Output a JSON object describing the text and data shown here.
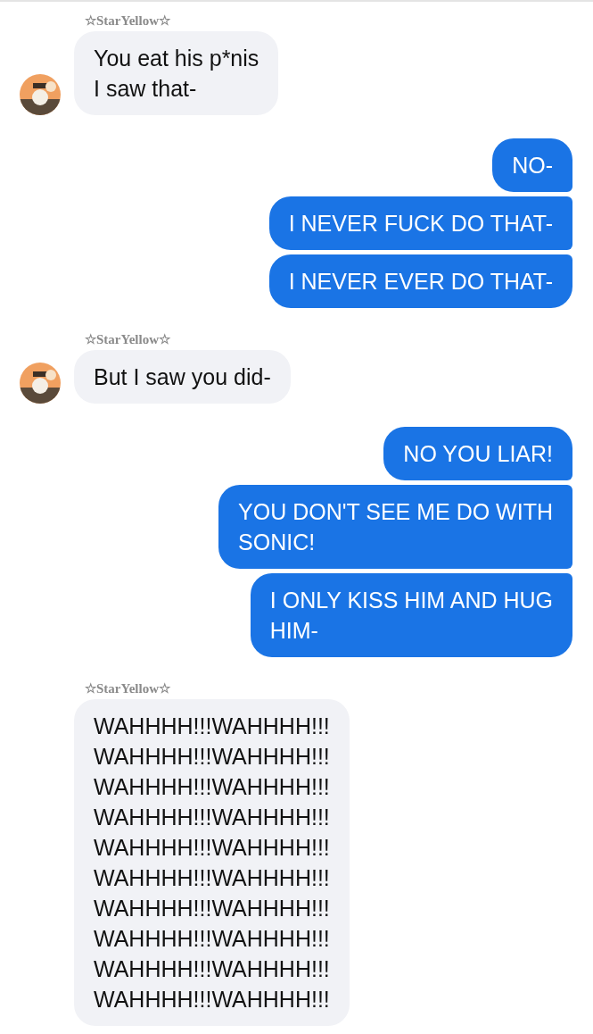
{
  "groups": [
    {
      "kind": "incoming",
      "sender": "☆StarYellow☆",
      "avatar": true,
      "messages": [
        "You eat his p*nis\nI saw that-"
      ]
    },
    {
      "kind": "outgoing",
      "messages": [
        "NO-",
        "I NEVER FUCK DO THAT-",
        "I NEVER EVER DO THAT-"
      ]
    },
    {
      "kind": "incoming",
      "sender": "☆StarYellow☆",
      "avatar": true,
      "messages": [
        "But I saw you did-"
      ]
    },
    {
      "kind": "outgoing",
      "messages": [
        "NO YOU LIAR!",
        "YOU DON'T SEE ME DO WITH\nSONIC!",
        "I ONLY KISS HIM AND HUG\nHIM-"
      ]
    },
    {
      "kind": "incoming",
      "sender": "☆StarYellow☆",
      "avatar": false,
      "messages": [
        "WAHHHH!!!WAHHHH!!!\nWAHHHH!!!WAHHHH!!!\nWAHHHH!!!WAHHHH!!!\nWAHHHH!!!WAHHHH!!!\nWAHHHH!!!WAHHHH!!!\nWAHHHH!!!WAHHHH!!!\nWAHHHH!!!WAHHHH!!!\nWAHHHH!!!WAHHHH!!!\nWAHHHH!!!WAHHHH!!!\nWAHHHH!!!WAHHHH!!!"
      ]
    }
  ]
}
